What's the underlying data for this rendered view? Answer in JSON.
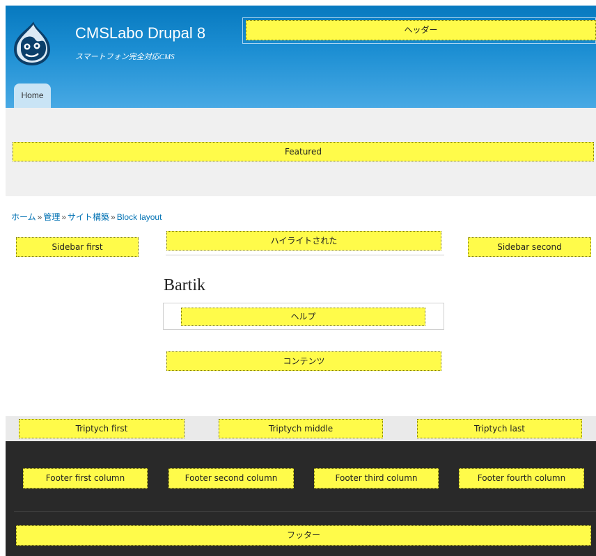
{
  "header": {
    "site_name": "CMSLabo Drupal 8",
    "slogan": "スマートフォン完全対応CMS",
    "region_label": "ヘッダー",
    "nav": {
      "home_label": "Home"
    }
  },
  "featured": {
    "label": "Featured"
  },
  "breadcrumb": {
    "items": [
      "ホーム",
      "管理",
      "サイト構築",
      "Block layout"
    ],
    "separator": "»"
  },
  "sidebar_first": {
    "label": "Sidebar first"
  },
  "sidebar_second": {
    "label": "Sidebar second"
  },
  "highlighted": {
    "label": "ハイライトされた"
  },
  "content": {
    "title": "Bartik",
    "help_label": "ヘルプ",
    "content_label": "コンテンツ"
  },
  "triptych": {
    "first": "Triptych first",
    "middle": "Triptych middle",
    "last": "Triptych last"
  },
  "footer": {
    "first": "Footer first column",
    "second": "Footer second column",
    "third": "Footer third column",
    "fourth": "Footer fourth column",
    "region_label": "フッター"
  },
  "colors": {
    "header_top": "#0779bf",
    "header_bottom": "#48a9e4",
    "block_placeholder": "#fffb4a",
    "link": "#0071b3",
    "footer_bg": "#292929"
  },
  "icons": {
    "logo": "drupal-drop-logo"
  }
}
